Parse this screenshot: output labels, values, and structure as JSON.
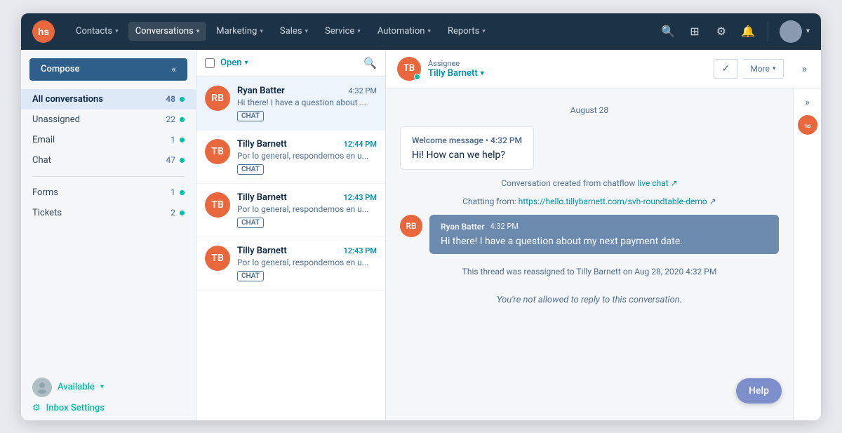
{
  "nav": {
    "items": [
      {
        "label": "Contacts",
        "active": false
      },
      {
        "label": "Conversations",
        "active": true
      },
      {
        "label": "Marketing",
        "active": false
      },
      {
        "label": "Sales",
        "active": false
      },
      {
        "label": "Service",
        "active": false
      },
      {
        "label": "Automation",
        "active": false
      },
      {
        "label": "Reports",
        "active": false
      }
    ]
  },
  "sidebar": {
    "compose_label": "Compose",
    "items": [
      {
        "label": "All conversations",
        "count": "48",
        "active": true
      },
      {
        "label": "Unassigned",
        "count": "22",
        "active": false
      },
      {
        "label": "Email",
        "count": "1",
        "active": false
      },
      {
        "label": "Chat",
        "count": "47",
        "active": false
      }
    ],
    "items2": [
      {
        "label": "Forms",
        "count": "1",
        "active": false
      },
      {
        "label": "Tickets",
        "count": "2",
        "active": false
      }
    ],
    "available_label": "Available",
    "inbox_settings_label": "Inbox Settings"
  },
  "conv_list": {
    "open_label": "Open",
    "conversations": [
      {
        "name": "Ryan Batter",
        "time": "4:32 PM",
        "time_highlight": false,
        "preview": "Hi there! I have a question about ...",
        "badge": "CHAT",
        "active": true,
        "initials": "RB"
      },
      {
        "name": "Tilly Barnett",
        "time": "12:44 PM",
        "time_highlight": true,
        "preview": "Por lo general, respondemos en u...",
        "badge": "CHAT",
        "active": false,
        "initials": "TB"
      },
      {
        "name": "Tilly Barnett",
        "time": "12:43 PM",
        "time_highlight": true,
        "preview": "Por lo general, respondemos en u...",
        "badge": "CHAT",
        "active": false,
        "initials": "TB"
      },
      {
        "name": "Tilly Barnett",
        "time": "12:43 PM",
        "time_highlight": true,
        "preview": "Por lo general, respondemos en u...",
        "badge": "CHAT",
        "active": false,
        "initials": "TB"
      }
    ]
  },
  "chat": {
    "assignee_label": "Assignee",
    "assignee_name": "Tilly Barnett",
    "more_label": "More",
    "date_divider": "August 28",
    "welcome_message": {
      "meta": "Welcome message • 4:32 PM",
      "text": "Hi! How can we help?"
    },
    "system_messages": [
      "Conversation created from chatflow live chat ↗",
      "Chatting from: https://hello.tillybarnett.com/svh-roundtable-demo ↗"
    ],
    "user_message": {
      "name": "Ryan Batter",
      "time": "4:32 PM",
      "text": "Hi there! I have a question about my next payment date.",
      "initials": "RB"
    },
    "reassign_notice": "This thread was reassigned to Tilly Barnett on Aug 28, 2020 4:32 PM",
    "no_reply_notice": "You're not allowed to reply to this conversation.",
    "chatflow_link": "live chat",
    "chatflow_url": "https://hello.tillybarnett.com/svh-roundtable-demo"
  },
  "help_label": "Help"
}
